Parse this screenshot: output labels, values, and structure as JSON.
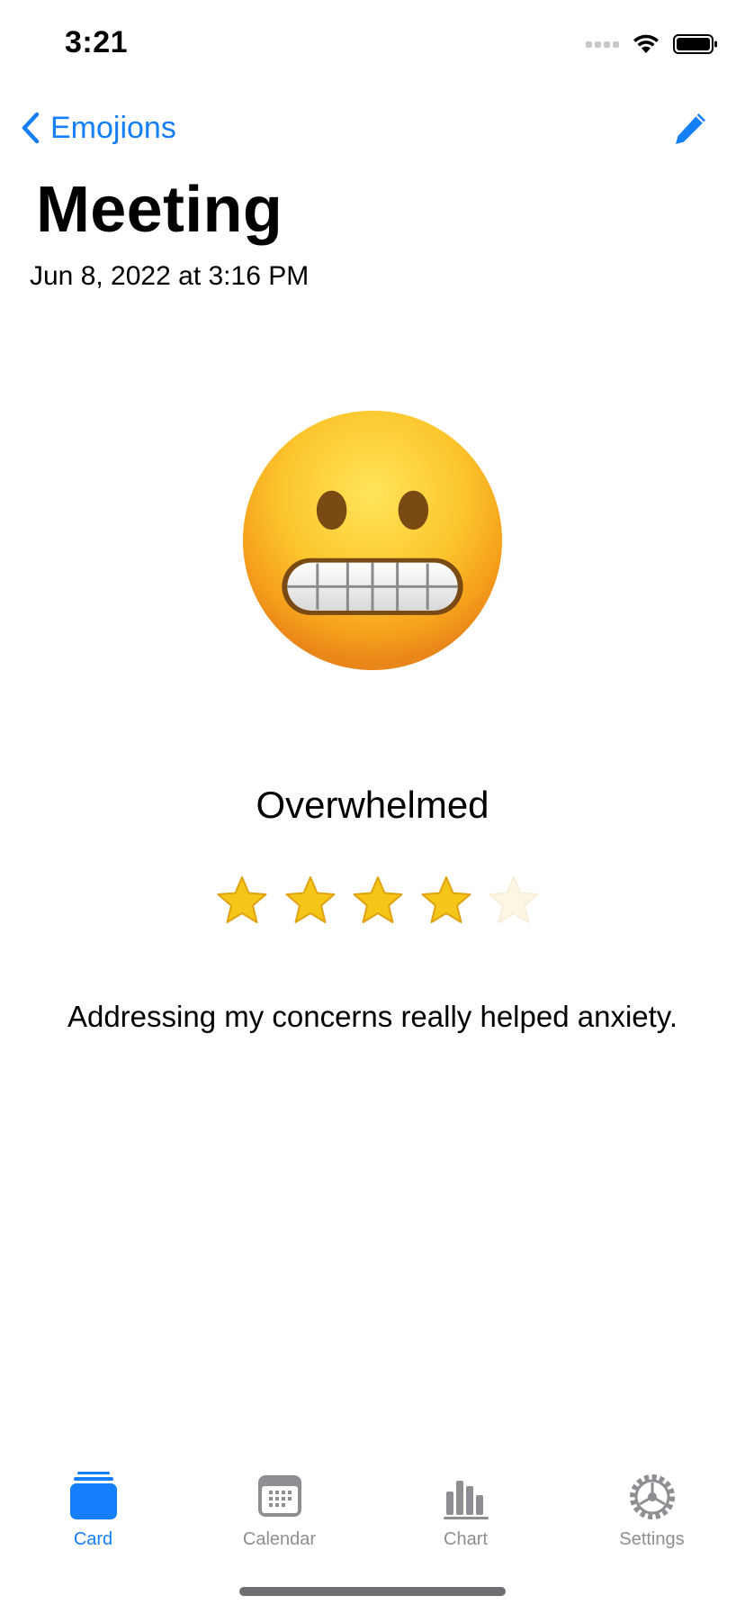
{
  "status_bar": {
    "time": "3:21"
  },
  "nav": {
    "back_label": "Emojions",
    "back_icon": "chevron-left-icon",
    "edit_icon": "pencil-icon"
  },
  "entry": {
    "title": "Meeting",
    "date": "Jun 8, 2022 at 3:16 PM",
    "emoji": "grimacing-face",
    "mood": "Overwhelmed",
    "rating": 4,
    "rating_max": 5,
    "note": "Addressing my concerns really helped anxiety."
  },
  "tabs": [
    {
      "label": "Card",
      "icon": "card-stack-icon",
      "active": true
    },
    {
      "label": "Calendar",
      "icon": "calendar-icon",
      "active": false
    },
    {
      "label": "Chart",
      "icon": "bar-chart-icon",
      "active": false
    },
    {
      "label": "Settings",
      "icon": "gear-icon",
      "active": false
    }
  ],
  "colors": {
    "accent": "#147efb",
    "inactive": "#8e8e93",
    "star": "#f5c518"
  }
}
